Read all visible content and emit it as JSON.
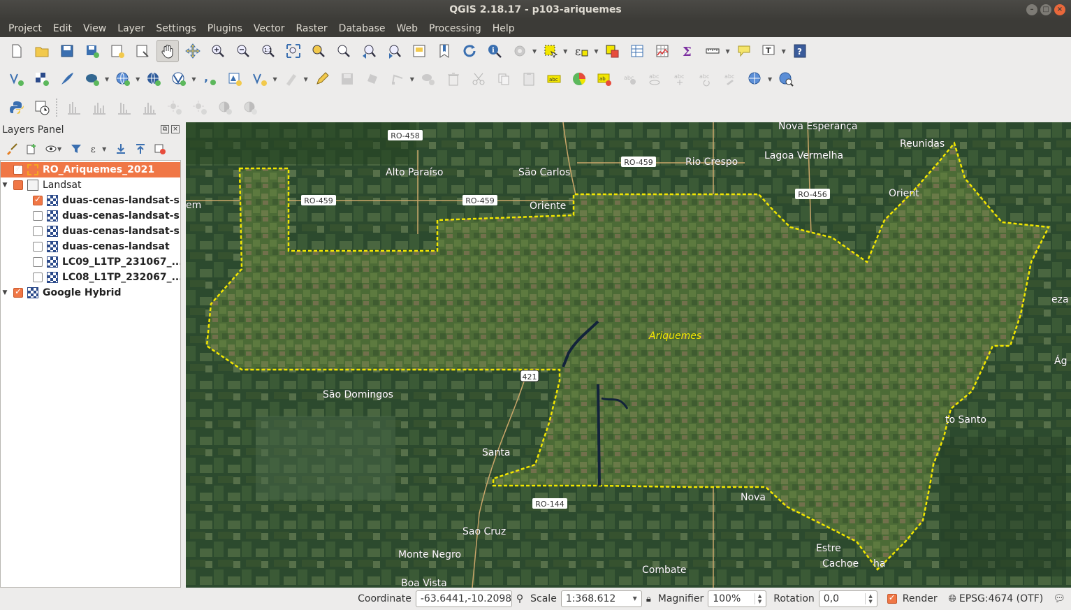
{
  "window": {
    "title": "QGIS 2.18.17 - p103-ariquemes"
  },
  "menu": [
    "Project",
    "Edit",
    "View",
    "Layer",
    "Settings",
    "Plugins",
    "Vector",
    "Raster",
    "Database",
    "Web",
    "Processing",
    "Help"
  ],
  "layers_panel": {
    "title": "Layers Panel",
    "layers": [
      {
        "label": "RO_Ariquemes_2021",
        "checked": true,
        "selected": true,
        "type": "polygon"
      },
      {
        "label": "Landsat",
        "checked": true,
        "type": "group"
      },
      {
        "label": "duas-cenas-landsat-s...",
        "checked": true,
        "type": "raster"
      },
      {
        "label": "duas-cenas-landsat-s...",
        "checked": false,
        "type": "raster"
      },
      {
        "label": "duas-cenas-landsat-s...",
        "checked": false,
        "type": "raster"
      },
      {
        "label": "duas-cenas-landsat",
        "checked": false,
        "type": "raster"
      },
      {
        "label": "LC09_L1TP_231067_...",
        "checked": false,
        "type": "raster"
      },
      {
        "label": "LC08_L1TP_232067_...",
        "checked": false,
        "type": "raster"
      },
      {
        "label": "Google Hybrid",
        "checked": true,
        "type": "raster"
      }
    ]
  },
  "map": {
    "highlight_label": "Ariquemes",
    "places": [
      "Nova Esperança",
      "Reunidas",
      "Lagoa Vermelha",
      "Rio Crespo",
      "Alto Paraíso",
      "São Carlos",
      "Oriente",
      "Orient",
      "São Domingos",
      "Santa",
      "Sao Cruz",
      "Monte Negro",
      "Boa Vista",
      "Combate",
      "Nova",
      "Estre",
      "Cachoe",
      "ha",
      "to Santo",
      "eza",
      "Ág",
      "em"
    ],
    "roads": [
      "RO-458",
      "RO-459",
      "RO-459",
      "RO-459",
      "RO-456",
      "421",
      "RO-144"
    ]
  },
  "status": {
    "coordinate_label": "Coordinate",
    "coordinate_value": "-63.6441,-10.2098",
    "scale_label": "Scale",
    "scale_value": "1:368.612",
    "magnifier_label": "Magnifier",
    "magnifier_value": "100%",
    "rotation_label": "Rotation",
    "rotation_value": "0,0",
    "render_label": "Render",
    "crs": "EPSG:4674 (OTF)"
  },
  "colors": {
    "accent": "#f07746",
    "polygon_outline": "#f2e600",
    "titlebar": "#3c3b37"
  }
}
